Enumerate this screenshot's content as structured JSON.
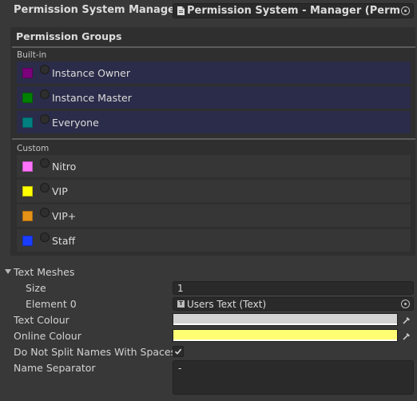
{
  "header": {
    "title": "Permission System Manager",
    "object_field": "Permission System - Manager (Permiss"
  },
  "groups": {
    "title": "Permission Groups",
    "builtin_label": "Built-in",
    "builtin": [
      {
        "label": "Instance Owner",
        "color": "#7b007b"
      },
      {
        "label": "Instance Master",
        "color": "#008000"
      },
      {
        "label": "Everyone",
        "color": "#008080"
      }
    ],
    "custom_label": "Custom",
    "custom": [
      {
        "label": "Nitro",
        "color": "#ff73fa"
      },
      {
        "label": "VIP",
        "color": "#ffff00"
      },
      {
        "label": "VIP+",
        "color": "#e69117"
      },
      {
        "label": "Staff",
        "color": "#1b3dff"
      }
    ]
  },
  "text_meshes": {
    "label": "Text Meshes",
    "size_label": "Size",
    "size_value": "1",
    "element_label": "Element 0",
    "element_value": "Users Text (Text)"
  },
  "text_colour": {
    "label": "Text Colour",
    "color": "#d2d2d2"
  },
  "online_colour": {
    "label": "Online Colour",
    "color": "#ffff73"
  },
  "split_names": {
    "label": "Do Not Split Names With Spaces",
    "checked": true
  },
  "name_separator": {
    "label": "Name Separator",
    "value": "-"
  }
}
